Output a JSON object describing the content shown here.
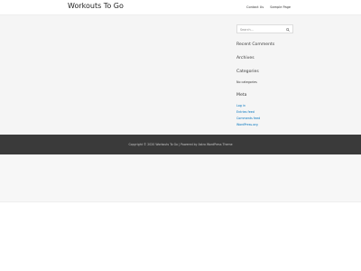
{
  "header": {
    "site_title": "Workouts To Go",
    "nav": [
      "Contact Us",
      "Sample Page"
    ]
  },
  "sidebar": {
    "search_placeholder": "Search...",
    "recent_comments_title": "Recent Comments",
    "archives_title": "Archives",
    "categories_title": "Categories",
    "categories_text": "No categories",
    "meta_title": "Meta",
    "meta_links": [
      "Log in",
      "Entries feed",
      "Comments feed",
      "WordPress.org"
    ]
  },
  "footer": {
    "text": "Copyright © 2020 Workouts To Go | Powered by Astra WordPress Theme"
  },
  "colors": {
    "link": "#0274be",
    "footer_bg": "#3a3a3a",
    "content_bg": "#f5f5f5"
  }
}
